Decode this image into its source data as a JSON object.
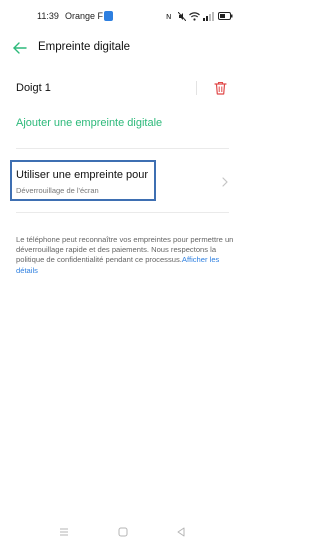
{
  "status_bar": {
    "time": "11:39",
    "carrier": "Orange F"
  },
  "header": {
    "title": "Empreinte digitale"
  },
  "finger": {
    "label": "Doigt 1"
  },
  "actions": {
    "add_fingerprint": "Ajouter une empreinte digitale"
  },
  "use_for": {
    "title": "Utiliser une empreinte pour",
    "subtitle": "Déverrouillage de l'écran"
  },
  "info": {
    "text": "Le téléphone peut reconnaître vos empreintes pour permettre un déverrouillage rapide et des paiements. Nous respectons la politique de confidentialité pendant ce processus.",
    "link": "Afficher les détails"
  },
  "colors": {
    "accent": "#2cb97a",
    "delete": "#e04848",
    "link": "#2d7fe0",
    "highlight_box": "#3e6fb2"
  },
  "icons": [
    "back-arrow-icon",
    "trash-icon",
    "chevron-right-icon",
    "wifi-icon",
    "signal-icon",
    "battery-icon",
    "nfc-icon",
    "mute-icon"
  ]
}
